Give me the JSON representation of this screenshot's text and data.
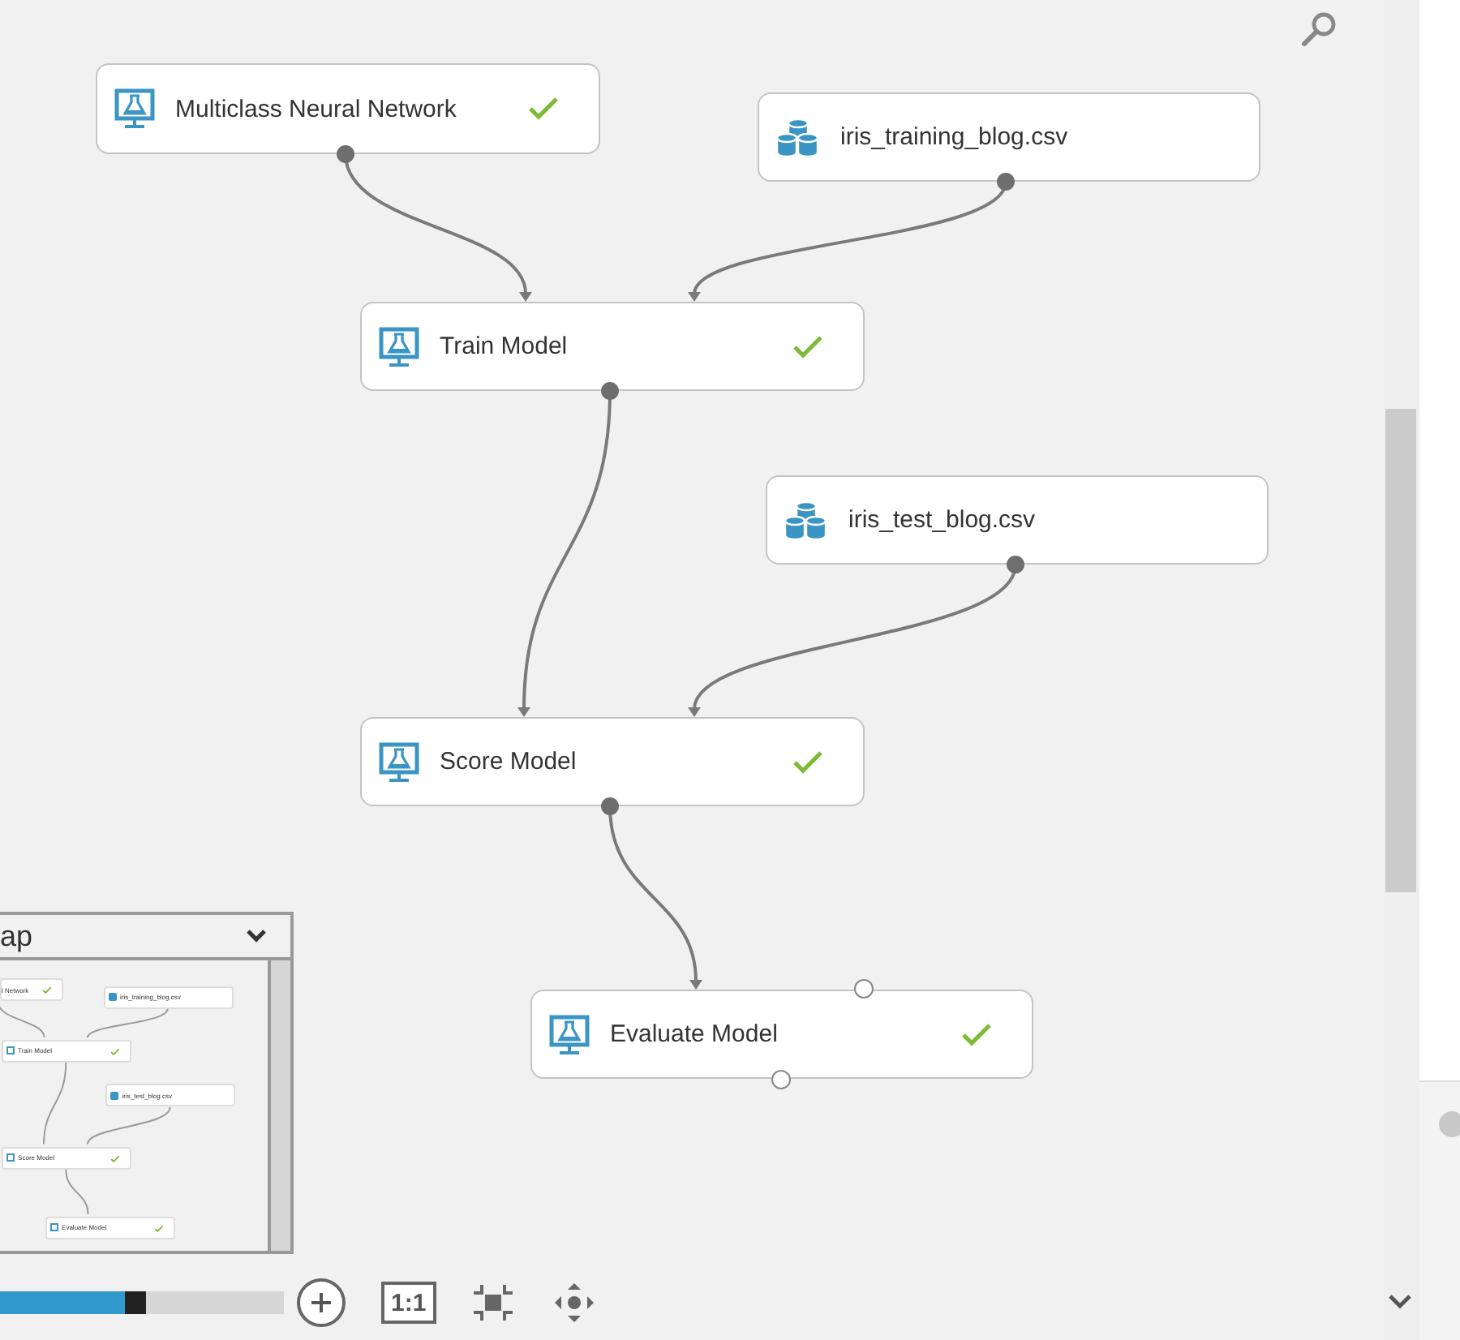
{
  "canvas": {
    "nodes": [
      {
        "kind": "module",
        "label": "Multiclass Neural Network",
        "done": true
      },
      {
        "kind": "dataset",
        "label": "iris_training_blog.csv",
        "done": false
      },
      {
        "kind": "module",
        "label": "Train Model",
        "done": true
      },
      {
        "kind": "dataset",
        "label": "iris_test_blog.csv",
        "done": false
      },
      {
        "kind": "module",
        "label": "Score Model",
        "done": true
      },
      {
        "kind": "module",
        "label": "Evaluate Model",
        "done": true
      }
    ]
  },
  "minimap": {
    "title": "ap",
    "nodes": [
      {
        "kind": "module",
        "label": "l Network",
        "done": true
      },
      {
        "kind": "dataset",
        "label": "iris_training_blog.csv",
        "done": false
      },
      {
        "kind": "module",
        "label": "Train Model",
        "done": true
      },
      {
        "kind": "dataset",
        "label": "iris_test_blog.csv",
        "done": false
      },
      {
        "kind": "module",
        "label": "Score Model",
        "done": true
      },
      {
        "kind": "module",
        "label": "Evaluate Model",
        "done": true
      }
    ]
  },
  "zoom": {
    "level": 0.48,
    "actual_size_label": "1:1"
  }
}
